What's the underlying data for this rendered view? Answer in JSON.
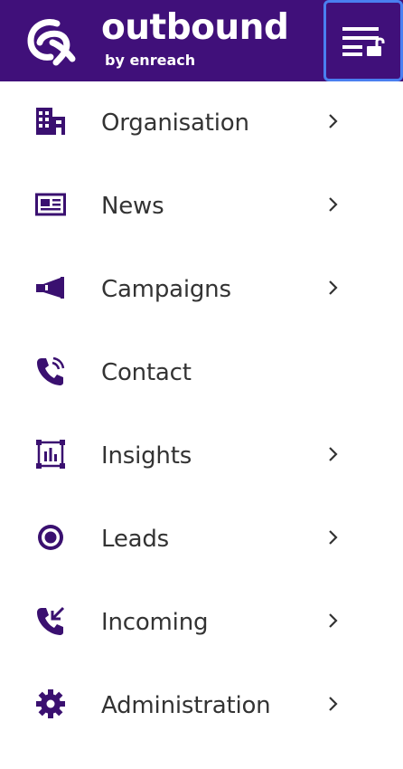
{
  "header": {
    "brand_name": "outbound",
    "brand_sub": "by enreach",
    "brand_color": "#40107a",
    "toggle_icon": "menu-lock-icon"
  },
  "nav": {
    "icon_color": "#3a1070",
    "items": [
      {
        "label": "Organisation",
        "icon": "buildings-icon",
        "has_chevron": true
      },
      {
        "label": "News",
        "icon": "newspaper-icon",
        "has_chevron": true
      },
      {
        "label": "Campaigns",
        "icon": "megaphone-icon",
        "has_chevron": true
      },
      {
        "label": "Contact",
        "icon": "phone-ringing-icon",
        "has_chevron": false
      },
      {
        "label": "Insights",
        "icon": "bar-chart-icon",
        "has_chevron": true
      },
      {
        "label": "Leads",
        "icon": "target-icon",
        "has_chevron": true
      },
      {
        "label": "Incoming",
        "icon": "phone-incoming-icon",
        "has_chevron": true
      },
      {
        "label": "Administration",
        "icon": "gear-icon",
        "has_chevron": true
      }
    ]
  }
}
